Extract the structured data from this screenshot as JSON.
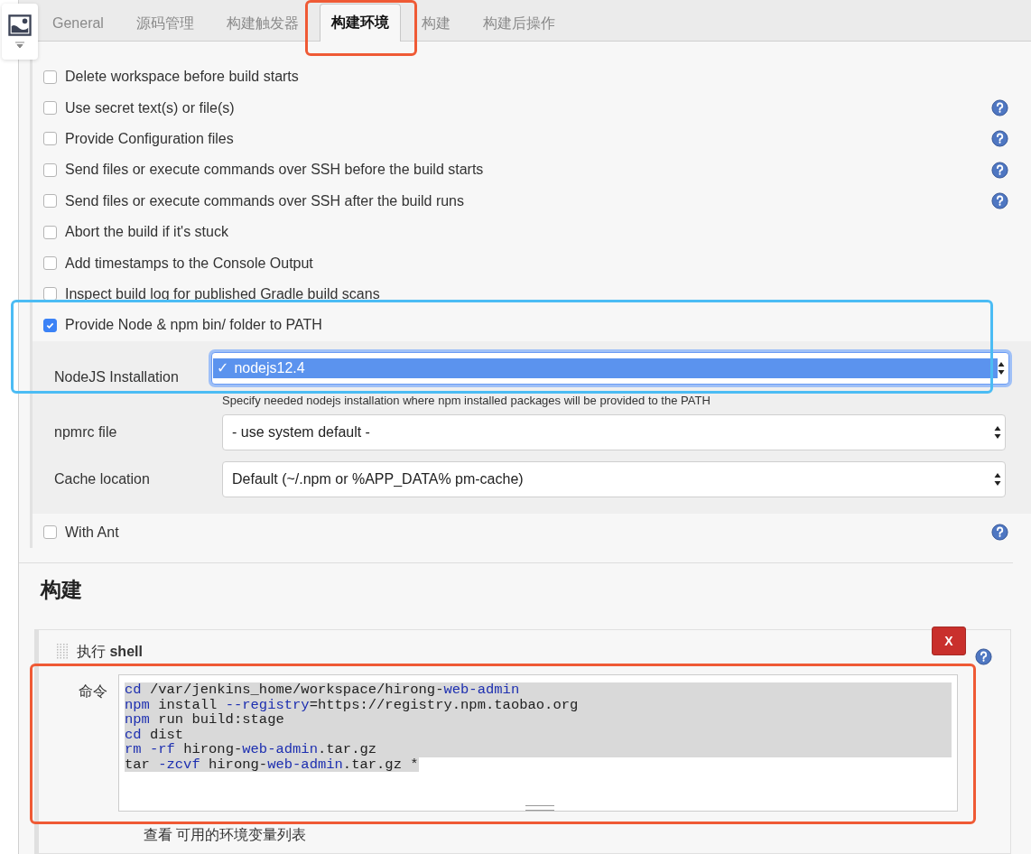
{
  "tabs": [
    {
      "label": "General",
      "selected": false
    },
    {
      "label": "源码管理",
      "selected": false
    },
    {
      "label": "构建触发器",
      "selected": false
    },
    {
      "label": "构建环境",
      "selected": true
    },
    {
      "label": "构建",
      "selected": false
    },
    {
      "label": "构建后操作",
      "selected": false
    }
  ],
  "env_options": [
    {
      "label": "Delete workspace before build starts",
      "checked": false,
      "help": false
    },
    {
      "label": "Use secret text(s) or file(s)",
      "checked": false,
      "help": true
    },
    {
      "label": "Provide Configuration files",
      "checked": false,
      "help": true
    },
    {
      "label": "Send files or execute commands over SSH before the build starts",
      "checked": false,
      "help": true
    },
    {
      "label": "Send files or execute commands over SSH after the build runs",
      "checked": false,
      "help": true
    },
    {
      "label": "Abort the build if it's stuck",
      "checked": false,
      "help": false
    },
    {
      "label": "Add timestamps to the Console Output",
      "checked": false,
      "help": false
    },
    {
      "label": "Inspect build log for published Gradle build scans",
      "checked": false,
      "help": false
    },
    {
      "label": "Provide Node & npm bin/ folder to PATH",
      "checked": true,
      "help": false
    }
  ],
  "node_settings": [
    {
      "label": "NodeJS Installation",
      "kind": "open",
      "mark": "✓",
      "value": "nodejs12.4",
      "hint": "Specify needed nodejs installation where npm installed packages will be provided to the PATH"
    },
    {
      "label": "npmrc file",
      "kind": "closed",
      "value": "- use system default -"
    },
    {
      "label": "Cache location",
      "kind": "closed",
      "value": "Default (~/.npm or %APP_DATA% pm-cache)"
    }
  ],
  "after_options": [
    {
      "label": "With Ant",
      "checked": false,
      "help": true
    }
  ],
  "build": {
    "heading": "构建",
    "step": {
      "title_prefix": "执行",
      "title": "shell",
      "delete": "X",
      "command_label": "命令",
      "lines": [
        {
          "selected": true,
          "parts": [
            {
              "t": "cd",
              "keyword": true
            },
            {
              "t": " /var/jenkins_home/workspace/hirong-",
              "keyword": false
            },
            {
              "t": "web-admin",
              "keyword": true
            }
          ]
        },
        {
          "selected": true,
          "parts": [
            {
              "t": "npm",
              "keyword": true
            },
            {
              "t": " install ",
              "keyword": false
            },
            {
              "t": "--registry",
              "keyword": true
            },
            {
              "t": "=https://registry.npm.taobao.org",
              "keyword": false
            }
          ]
        },
        {
          "selected": true,
          "parts": [
            {
              "t": "npm",
              "keyword": true
            },
            {
              "t": " run build:stage",
              "keyword": false
            }
          ]
        },
        {
          "selected": true,
          "parts": [
            {
              "t": "cd",
              "keyword": true
            },
            {
              "t": " dist",
              "keyword": false
            }
          ]
        },
        {
          "selected": true,
          "parts": [
            {
              "t": "rm",
              "keyword": true
            },
            {
              "t": " -rf",
              "keyword": true
            },
            {
              "t": " hirong-",
              "keyword": false
            },
            {
              "t": "web-admin",
              "keyword": true
            },
            {
              "t": ".tar.gz",
              "keyword": false
            }
          ]
        },
        {
          "selected": true,
          "parts": [
            {
              "t": "tar",
              "keyword": false
            },
            {
              "t": " -zcvf",
              "keyword": true
            },
            {
              "t": " hirong-",
              "keyword": false
            },
            {
              "t": "web-admin",
              "keyword": true
            },
            {
              "t": ".tar.gz *",
              "keyword": false
            }
          ]
        }
      ],
      "env_link": "查看 可用的环境变量列表"
    }
  }
}
